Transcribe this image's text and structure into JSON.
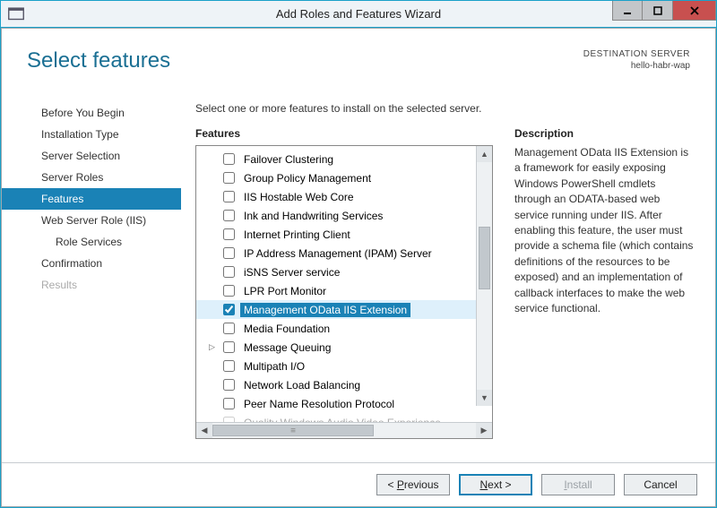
{
  "window": {
    "title": "Add Roles and Features Wizard"
  },
  "header": {
    "heading": "Select features",
    "dest_label": "DESTINATION SERVER",
    "dest_value": "hello-habr-wap"
  },
  "nav": {
    "items": [
      {
        "label": "Before You Begin",
        "state": "normal"
      },
      {
        "label": "Installation Type",
        "state": "normal"
      },
      {
        "label": "Server Selection",
        "state": "normal"
      },
      {
        "label": "Server Roles",
        "state": "normal"
      },
      {
        "label": "Features",
        "state": "selected"
      },
      {
        "label": "Web Server Role (IIS)",
        "state": "normal"
      },
      {
        "label": "Role Services",
        "state": "normal",
        "sub": true
      },
      {
        "label": "Confirmation",
        "state": "normal"
      },
      {
        "label": "Results",
        "state": "disabled"
      }
    ]
  },
  "main": {
    "instruction": "Select one or more features to install on the selected server.",
    "features_title": "Features",
    "description_title": "Description",
    "description_body": "Management OData IIS Extension is a framework for easily exposing Windows PowerShell cmdlets through an ODATA-based web service running under IIS. After enabling this feature, the user must provide a schema file (which contains definitions of the resources to be exposed) and an implementation of callback interfaces to make the web service functional.",
    "features": [
      {
        "label": "Failover Clustering",
        "checked": false
      },
      {
        "label": "Group Policy Management",
        "checked": false
      },
      {
        "label": "IIS Hostable Web Core",
        "checked": false
      },
      {
        "label": "Ink and Handwriting Services",
        "checked": false
      },
      {
        "label": "Internet Printing Client",
        "checked": false
      },
      {
        "label": "IP Address Management (IPAM) Server",
        "checked": false
      },
      {
        "label": "iSNS Server service",
        "checked": false
      },
      {
        "label": "LPR Port Monitor",
        "checked": false
      },
      {
        "label": "Management OData IIS Extension",
        "checked": true,
        "selected": true
      },
      {
        "label": "Media Foundation",
        "checked": false
      },
      {
        "label": "Message Queuing",
        "checked": false,
        "expandable": true
      },
      {
        "label": "Multipath I/O",
        "checked": false
      },
      {
        "label": "Network Load Balancing",
        "checked": false
      },
      {
        "label": "Peer Name Resolution Protocol",
        "checked": false
      },
      {
        "label": "Quality Windows Audio Video Experience",
        "checked": false,
        "cut": true
      }
    ]
  },
  "footer": {
    "previous": "Previous",
    "next": "Next",
    "install": "Install",
    "cancel": "Cancel"
  }
}
